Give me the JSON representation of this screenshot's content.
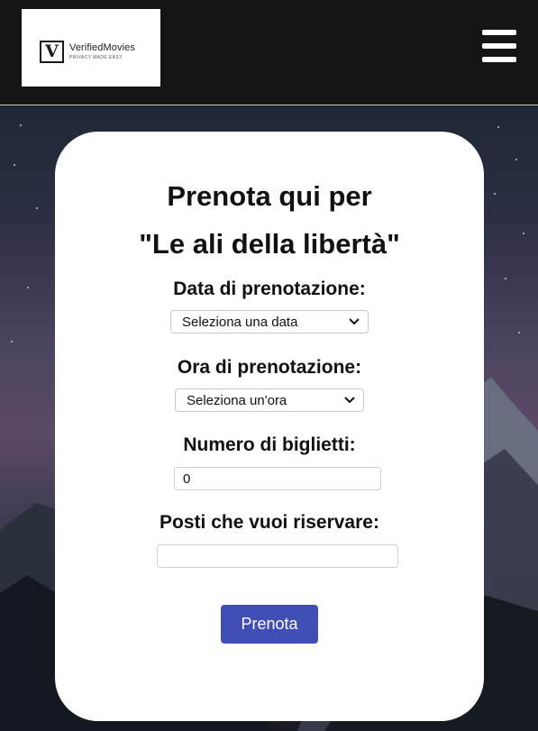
{
  "brand": {
    "name": "VerifiedMovies",
    "tagline": "PRIVACY MADE EASY",
    "mark_letter": "V"
  },
  "booking": {
    "title_line1": "Prenota qui per",
    "title_line2": "\"Le ali della libertà\"",
    "date_label": "Data di prenotazione:",
    "date_select_value": "Seleziona una data",
    "time_label": "Ora di prenotazione:",
    "time_select_value": "Seleziona un'ora",
    "tickets_label": "Numero di biglietti:",
    "tickets_value": "0",
    "seats_label": "Posti che vuoi riservare:",
    "seats_value": "",
    "submit_label": "Prenota"
  },
  "colors": {
    "navbar": "#141414",
    "button": "#3f4fb5"
  },
  "icons": {
    "menu": "hamburger-menu-icon",
    "select_arrow": "chevron-down-icon"
  }
}
